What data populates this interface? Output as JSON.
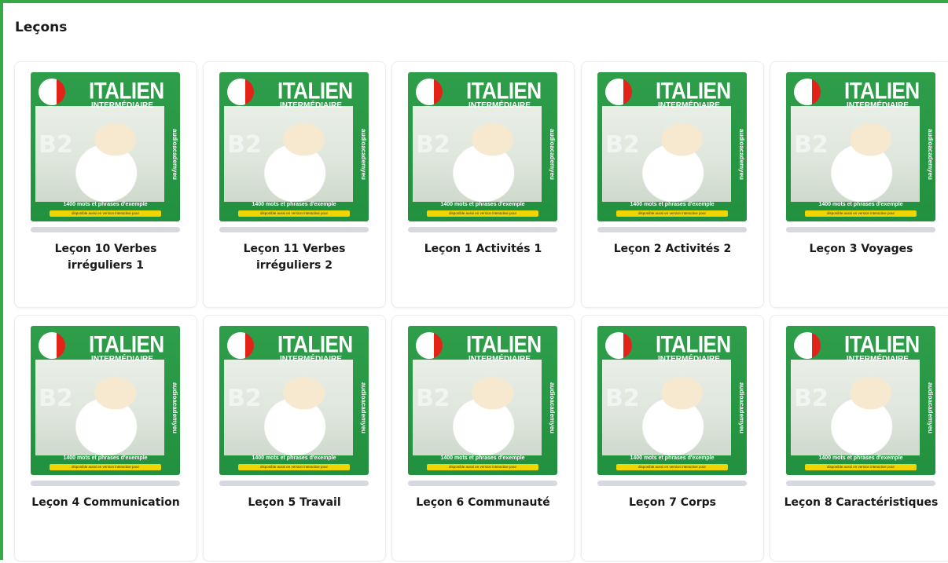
{
  "section": {
    "title": "Leçons"
  },
  "cover": {
    "title": "ITALIEN",
    "subtitle": "INTERMÉDIAIRE",
    "level": "B2",
    "brand": "audioacademyeu",
    "tagline": "1400 mots et phrases d'exemple",
    "strip": "disponible aussi en version interactive pour",
    "flag_colors": [
      "#ffffff",
      "#ffffff",
      "#e2231a"
    ],
    "green": "#2e9e4a"
  },
  "accent": "#36a845",
  "lessons": [
    {
      "label": "Leçon 10 Verbes irréguliers 1",
      "progress": 0
    },
    {
      "label": "Leçon 11 Verbes irréguliers 2",
      "progress": 0
    },
    {
      "label": "Leçon 1 Activités 1",
      "progress": 0
    },
    {
      "label": "Leçon 2 Activités 2",
      "progress": 0
    },
    {
      "label": "Leçon 3 Voyages",
      "progress": 0
    },
    {
      "label": "Leçon 4 Communication",
      "progress": 0
    },
    {
      "label": "Leçon 5 Travail",
      "progress": 0
    },
    {
      "label": "Leçon 6 Communauté",
      "progress": 0
    },
    {
      "label": "Leçon 7 Corps",
      "progress": 0
    },
    {
      "label": "Leçon 8 Caractéristiques",
      "progress": 0
    }
  ]
}
